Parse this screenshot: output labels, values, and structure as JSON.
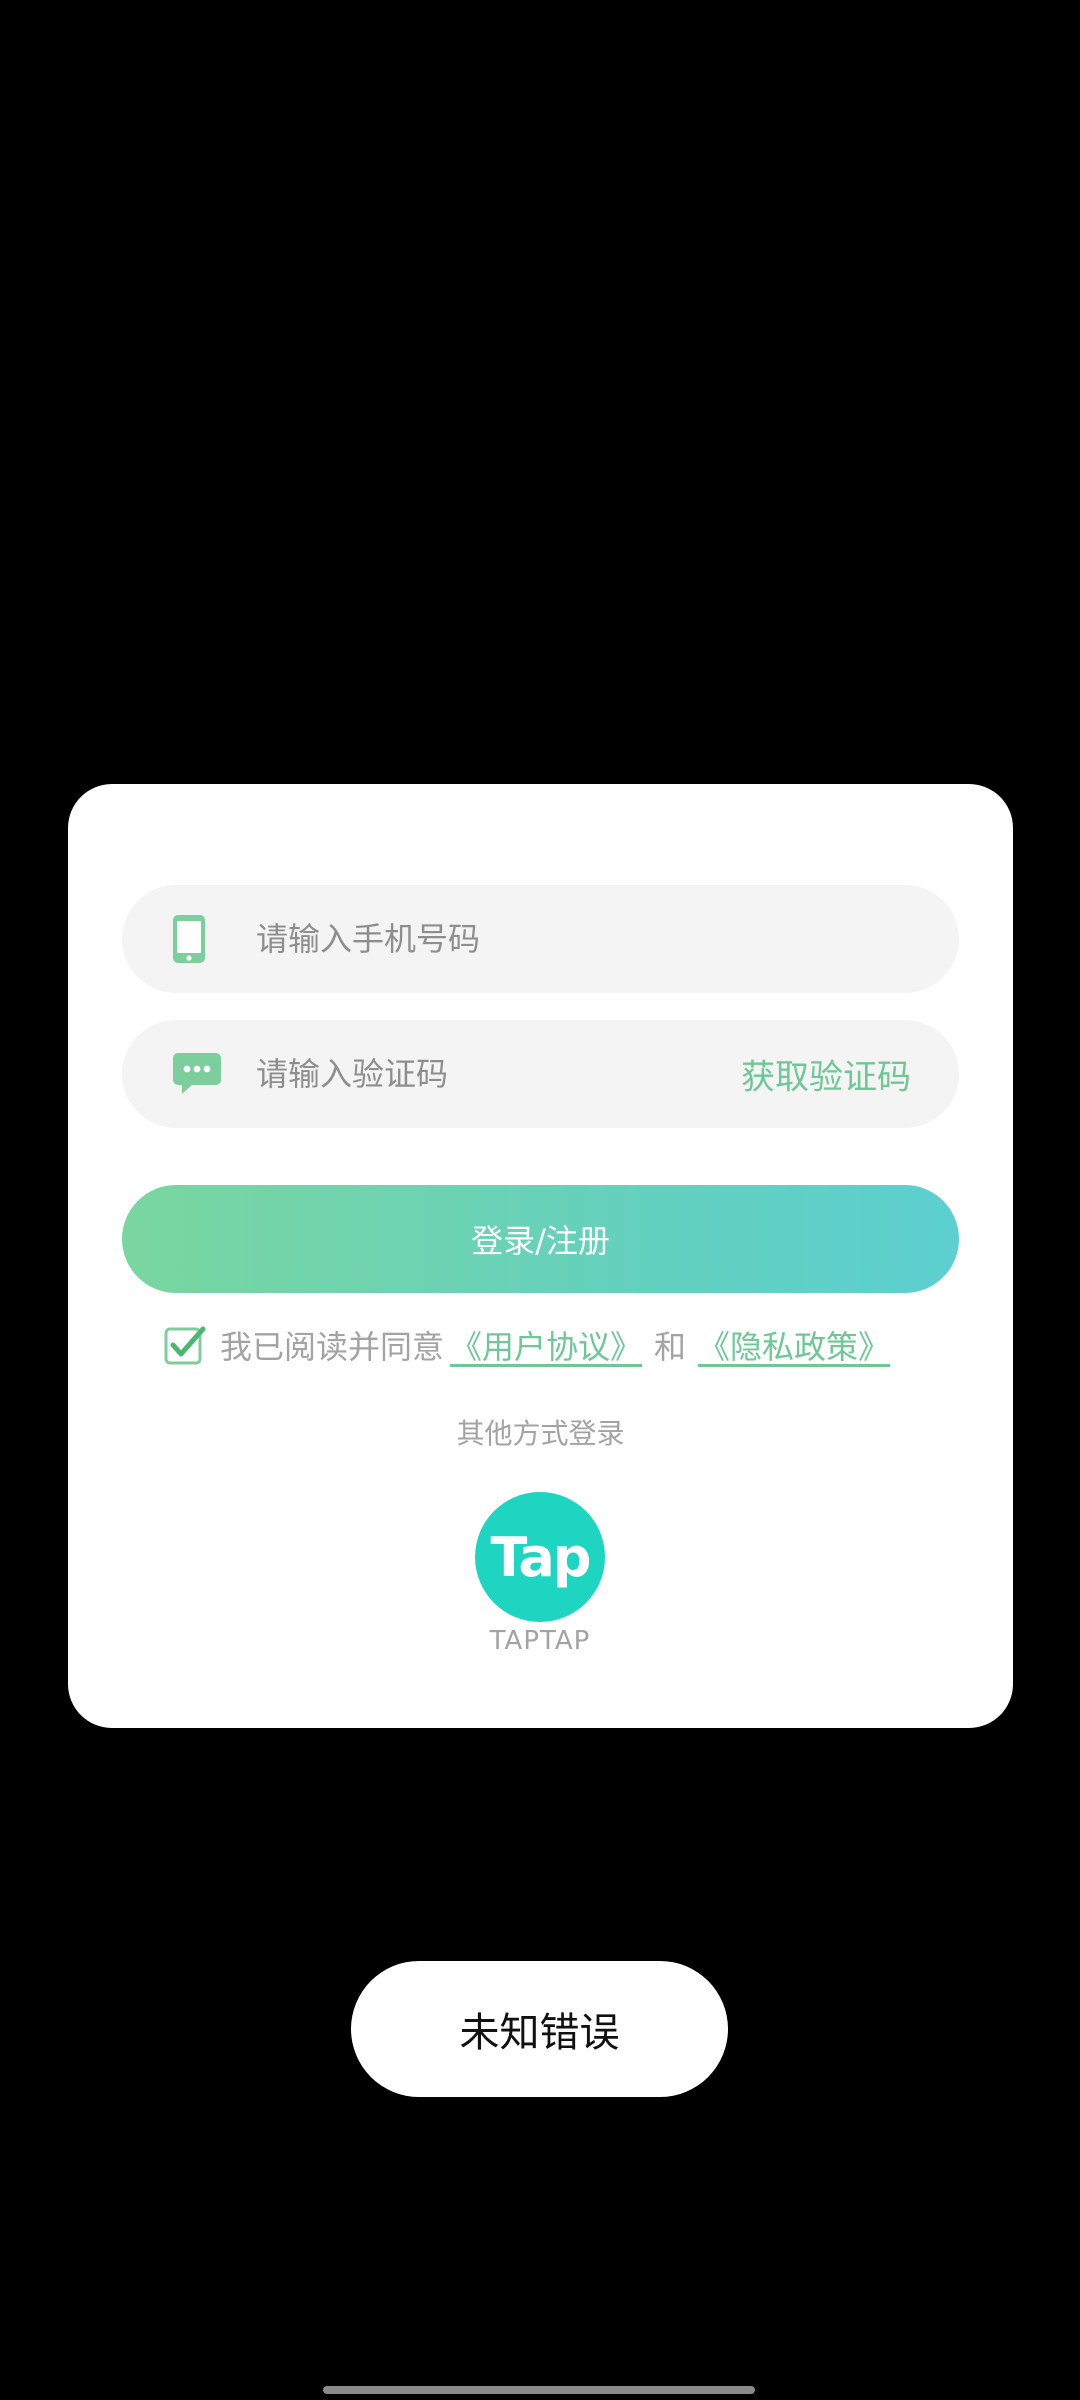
{
  "login_dialog": {
    "phone_field": {
      "placeholder": "请输入手机号码",
      "value": "",
      "icon": "smartphone-icon"
    },
    "code_field": {
      "placeholder": "请输入验证码",
      "value": "",
      "icon": "chat-bubble-icon",
      "get_code_label": "获取验证码"
    },
    "login_button_label": "登录/注册",
    "agreement": {
      "checked": true,
      "prefix": "我已阅读并同意",
      "user_agreement_label": "《用户协议》",
      "conjunction": "和",
      "privacy_policy_label": "《隐私政策》"
    },
    "other_login_label": "其他方式登录",
    "taptap": {
      "logo_text": "Tap",
      "label": "TAPTAP"
    }
  },
  "toast": {
    "message": "未知错误"
  },
  "colors": {
    "accent_green": "#6dc895",
    "gradient_start": "#7ad6a0",
    "gradient_end": "#5ccfd0",
    "taptap_teal": "#1ed5c1",
    "field_bg": "#f4f4f4",
    "muted_text": "#a3a3a3"
  }
}
